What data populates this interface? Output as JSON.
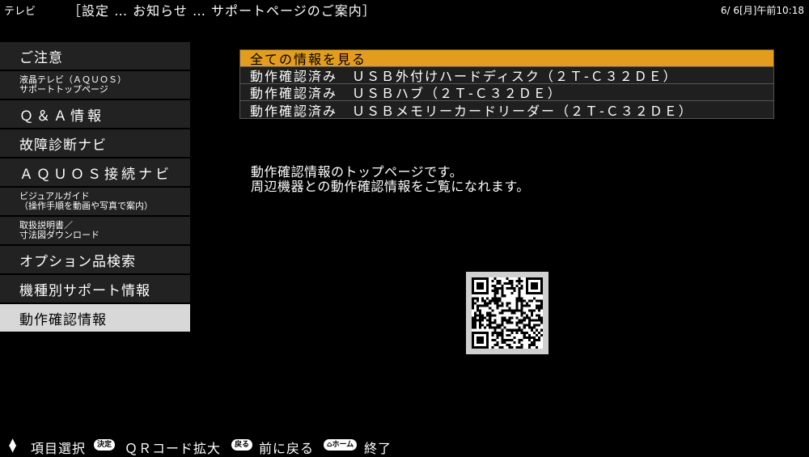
{
  "header": {
    "app": "テレビ",
    "breadcrumb": "［設定 … お知らせ … サポートページのご案内］",
    "clock": "6/ 6[月]午前10:18"
  },
  "sidebar": {
    "items": [
      {
        "label": "ご注意"
      },
      {
        "label": "液晶テレビ（ＡＱＵＯＳ）\nサポートトップページ"
      },
      {
        "label": "Ｑ＆Ａ情報"
      },
      {
        "label": "故障診断ナビ"
      },
      {
        "label": "ＡＱＵＯＳ接続ナビ"
      },
      {
        "label": "ビジュアルガイド\n（操作手順を動画や写真で案内）"
      },
      {
        "label": "取扱説明書／\n寸法図ダウンロード"
      },
      {
        "label": "オプション品検索"
      },
      {
        "label": "機種別サポート情報"
      },
      {
        "label": "動作確認情報"
      }
    ]
  },
  "list": {
    "items": [
      "全ての情報を見る",
      "動作確認済み　ＵＳＢ外付けハードディスク（２Ｔ-Ｃ３２ＤＥ）",
      "動作確認済み　ＵＳＢハブ（２Ｔ-Ｃ３２ＤＥ）",
      "動作確認済み　ＵＳＢメモリーカードリーダー（２Ｔ-Ｃ３２ＤＥ）"
    ]
  },
  "description": {
    "line1": "動作確認情報のトップページです。",
    "line2": "周辺機器との動作確認情報をご覧になれます。"
  },
  "footer": {
    "select_label": "項目選択",
    "enter_key": "決定",
    "qr_label": "ＱＲコード拡大",
    "back_key": "戻る",
    "back_label": "前に戻る",
    "home_key": "ホーム",
    "exit_label": "終了"
  },
  "colors": {
    "selected_list": "#e49c1e",
    "selected_sidebar": "#d8d8d8",
    "item_bg": "#222222"
  }
}
